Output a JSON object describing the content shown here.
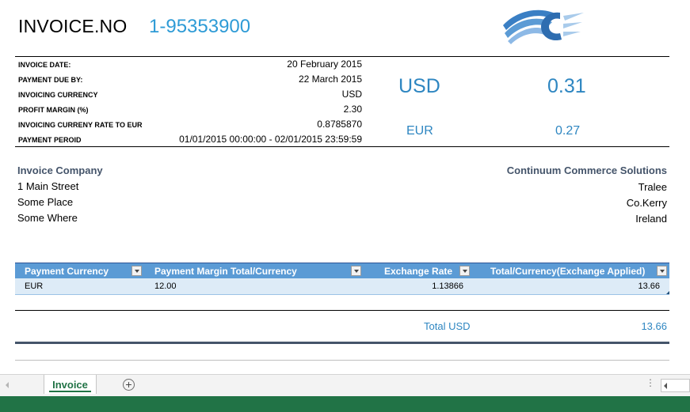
{
  "invoice": {
    "label": "INVOICE.NO",
    "number": "1-95353900"
  },
  "details": [
    {
      "label": "INVOICE DATE:",
      "value": "20 February 2015"
    },
    {
      "label": "PAYMENT DUE BY:",
      "value": "22 March 2015"
    },
    {
      "label": "INVOICING CURRENCY",
      "value": "USD"
    },
    {
      "label": "PROFIT MARGIN (%)",
      "value": "2.30"
    },
    {
      "label": "INVOICING CURRENY RATE TO EUR",
      "value": "0.8785870"
    },
    {
      "label": "PAYMENT PEROID",
      "value": "01/01/2015 00:00:00 - 02/01/2015 23:59:59"
    }
  ],
  "summary": {
    "primary_currency": "USD",
    "primary_amount": "0.31",
    "secondary_currency": "EUR",
    "secondary_amount": "0.27"
  },
  "from": {
    "name": "Invoice Company",
    "line1": "1 Main Street",
    "line2": "Some Place",
    "line3": "Some Where"
  },
  "to": {
    "name": "Continuum Commerce Solutions",
    "line1": "Tralee",
    "line2": "Co.Kerry",
    "line3": "Ireland"
  },
  "table": {
    "columns": [
      "Payment Currency",
      "Payment Margin Total/Currency",
      "Exchange Rate",
      "Total/Currency(Exchange Applied)"
    ],
    "rows": [
      [
        "EUR",
        "12.00",
        "1.13866",
        "13.66"
      ]
    ]
  },
  "total": {
    "label": "Total USD",
    "value": "13.66"
  },
  "sheets": {
    "active": "Invoice",
    "add_symbol": "+",
    "overflow": "⋮"
  },
  "colors": {
    "accent_blue": "#2E86C1",
    "table_header": "#5B9BD5",
    "excel_green": "#217346"
  },
  "icons": [
    "company-logo-icon",
    "dropdown-icon",
    "scroll-left-icon",
    "add-sheet-icon"
  ]
}
